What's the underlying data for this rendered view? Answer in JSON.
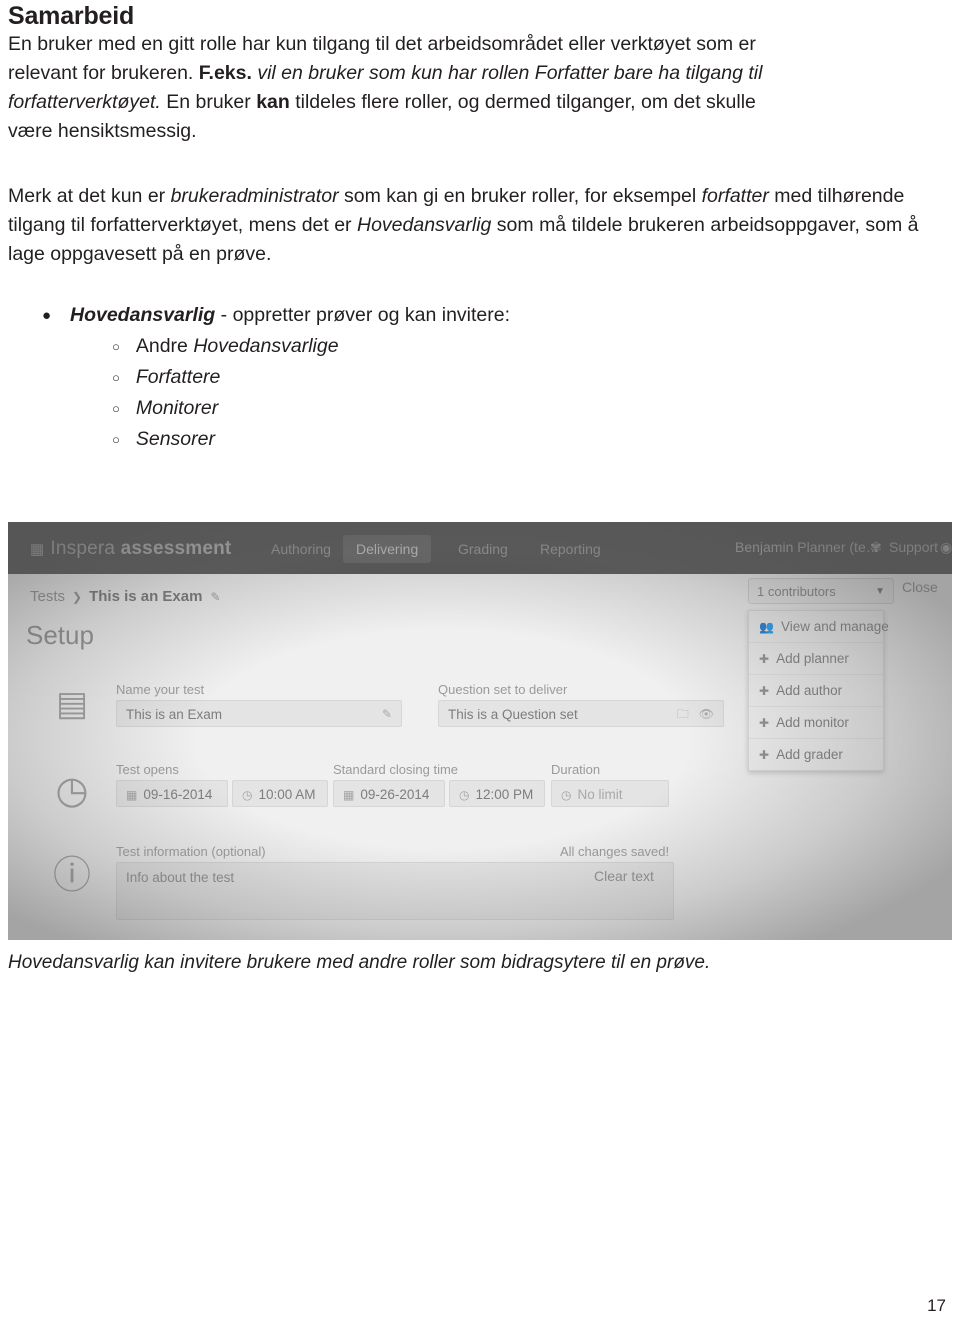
{
  "document": {
    "title": "Samarbeid",
    "page_number": "17",
    "paragraph1": {
      "line1_a": "En bruker med en gitt rolle har kun tilgang til det arbeidsområdet eller verktøyet som er",
      "line2_a": "relevant for brukeren.",
      "line2_b": "F.eks.",
      "line2_c": "vil en bruker som kun har rollen",
      "line2_d": "Forfatter",
      "line2_e": "bare ha tilgang til",
      "line3_a": "forfatterverktøyet.",
      "line3_b": "En bruker",
      "line3_c": "kan",
      "line3_d": "tildeles flere roller, og dermed tilganger, om det skulle",
      "line4_a": "være hensiktsmessig."
    },
    "paragraph2": {
      "a": "Merk at det kun er ",
      "b": "brukeradministrator",
      "c": " som kan gi en bruker roller, for eksempel ",
      "d": "forfatter",
      "e": " med tilhørende tilgang til forfatterverktøyet, mens det er ",
      "f": "Hovedansvarlig",
      "g": " som må tildele brukeren arbeidsoppgaver, som å lage oppgavesett på en prøve."
    },
    "bullet": {
      "role": "Hovedansvarlig",
      "description": " - oppretter prøver og kan invitere:",
      "sub_items": [
        {
          "prefix": "Andre ",
          "label": "Hovedansvarlige"
        },
        {
          "prefix": "",
          "label": "Forfattere"
        },
        {
          "prefix": "",
          "label": "Monitorer"
        },
        {
          "prefix": "",
          "label": "Sensorer"
        }
      ]
    },
    "caption": "Hovedansvarlig kan invitere brukere med andre roller som bidragsytere til en prøve."
  },
  "screenshot": {
    "brand": {
      "icon": "grid-icon",
      "name_light": "Inspera",
      "name_bold": "assessment"
    },
    "nav": [
      {
        "label": "Authoring",
        "active": false
      },
      {
        "label": "Delivering",
        "active": true
      },
      {
        "label": "Grading",
        "active": false
      },
      {
        "label": "Reporting",
        "active": false
      }
    ],
    "topright": {
      "user": "Benjamin Planner (te…",
      "gear_icon": "gear-icon",
      "support": "Support",
      "support_icon": "question-circle-icon"
    },
    "breadcrumb": {
      "root": "Tests",
      "separator": "❯",
      "current": "This is an Exam",
      "edit_icon": "pencil-icon"
    },
    "page_heading": "Setup",
    "fields": {
      "name_label": "Name your test",
      "name_value": "This is an Exam",
      "name_edit_icon": "pencil-icon",
      "qset_label": "Question set to deliver",
      "qset_value": "This is a Question set",
      "qset_folder_icon": "folder-icon",
      "qset_eye_icon": "eye-icon",
      "opens_label": "Test opens",
      "opens_date": "09-16-2014",
      "opens_time": "10:00 AM",
      "closing_label": "Standard closing time",
      "closing_date": "09-26-2014",
      "closing_time": "12:00 PM",
      "duration_label": "Duration",
      "duration_value": "No limit",
      "info_label": "Test information (optional)",
      "info_value": "Info about the test",
      "saved_text": "All changes saved!",
      "clear_text": "Clear text",
      "calendar_icon": "calendar-icon",
      "clock_icon": "clock-icon"
    },
    "contributors": {
      "select_value": "1 contributors",
      "caret_icon": "chevron-down-icon",
      "close_label": "Close",
      "menu": [
        {
          "icon": "users-icon",
          "label": "View and manage"
        },
        {
          "icon": "plus-icon",
          "label": "Add planner"
        },
        {
          "icon": "plus-icon",
          "label": "Add author"
        },
        {
          "icon": "plus-icon",
          "label": "Add monitor"
        },
        {
          "icon": "plus-icon",
          "label": "Add grader"
        }
      ]
    },
    "side_icons": {
      "document_icon": "document-icon",
      "clock_icon": "clock-circle-icon",
      "info_icon": "info-circle-icon"
    }
  }
}
